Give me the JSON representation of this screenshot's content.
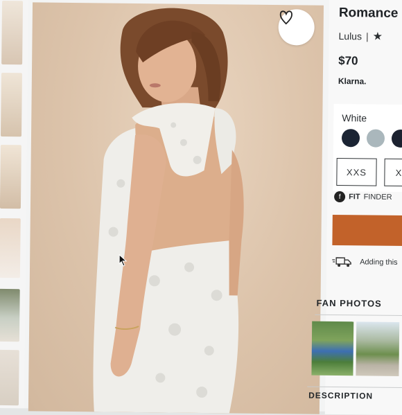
{
  "product": {
    "title": "Romance",
    "brand": "Lulus",
    "brand_separator": "|",
    "rating_star": "★",
    "price": "$70",
    "payment_provider": "Klarna."
  },
  "options": {
    "selected_color": "White",
    "swatches": [
      "#1b2433",
      "#aab7bc",
      "#1c2230"
    ],
    "sizes": [
      "XXS",
      "X"
    ]
  },
  "fit_finder": {
    "bold_label": "FIT",
    "label": "FINDER"
  },
  "shipping": {
    "text": "Adding this"
  },
  "fan_photos": {
    "heading": "FAN PHOTOS"
  },
  "description": {
    "heading": "DESCRIPTION"
  },
  "icons": {
    "favorite": "heart-icon",
    "fit_finder": "fit-finder-logo-icon",
    "shipping": "delivery-truck-icon",
    "cursor": "mouse-cursor-icon"
  }
}
